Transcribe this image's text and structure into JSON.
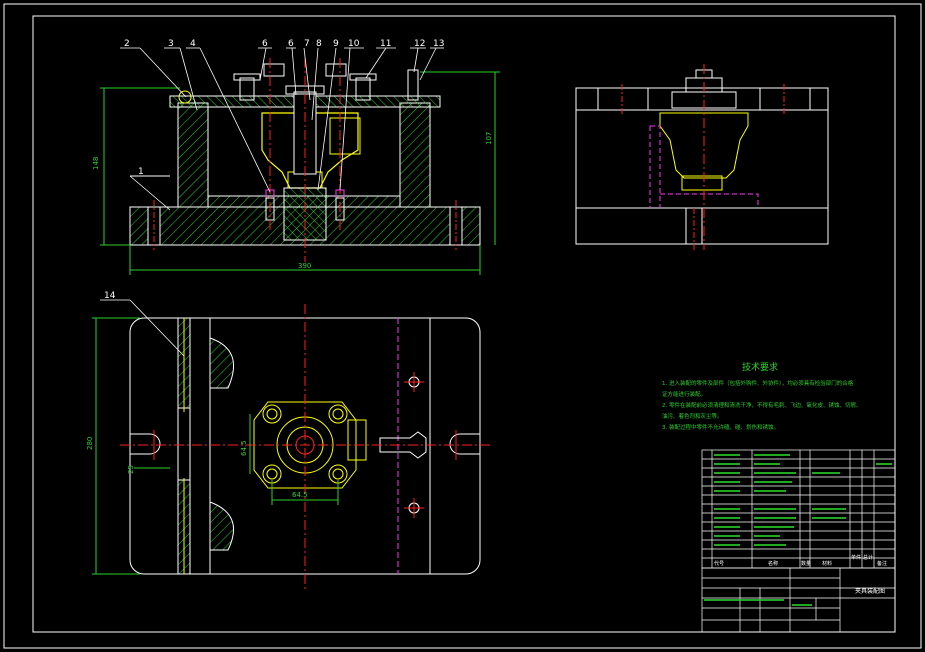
{
  "colors": {
    "background": "#000000",
    "outline": "#ffffff",
    "hatch": "#2bd12b",
    "dim": "#2bd12b",
    "center": "#ff2020",
    "hidden": "#ff33ff",
    "part": "#ffff00",
    "leader": "#ffffff"
  },
  "part_labels": [
    "2",
    "3",
    "4",
    "6",
    "6",
    "7",
    "8",
    "9",
    "10",
    "11",
    "12",
    "13",
    "1",
    "14"
  ],
  "dimensions": {
    "overall_width": "390",
    "overall_height_left": "148",
    "overall_height_right": "107",
    "plan_height": "280",
    "bolt_square_h": "64.5",
    "bolt_square_v": "64.5",
    "slot_width": "25"
  },
  "tech_requirements": {
    "title": "技术要求",
    "lines": [
      "1. 进入装配的零件及部件（包括外购件、外协件），均必须具有检验部门的合格",
      "   证方能进行装配。",
      "2. 零件在装配前必须清理和清洗干净，不得有毛刺、飞边、氧化皮、锈蚀、切屑、",
      "   油污、着色剂和灰尘等。",
      "3. 装配过程中零件不允许磕、碰、划伤和锈蚀。"
    ]
  },
  "title_block": {
    "drawing_name": "夹具装配图",
    "header_code": "代号",
    "header_name": "名称",
    "header_qty": "数量",
    "header_material": "材料",
    "header_weight_single": "单件",
    "header_weight_total": "总计",
    "header_note": "备注"
  }
}
